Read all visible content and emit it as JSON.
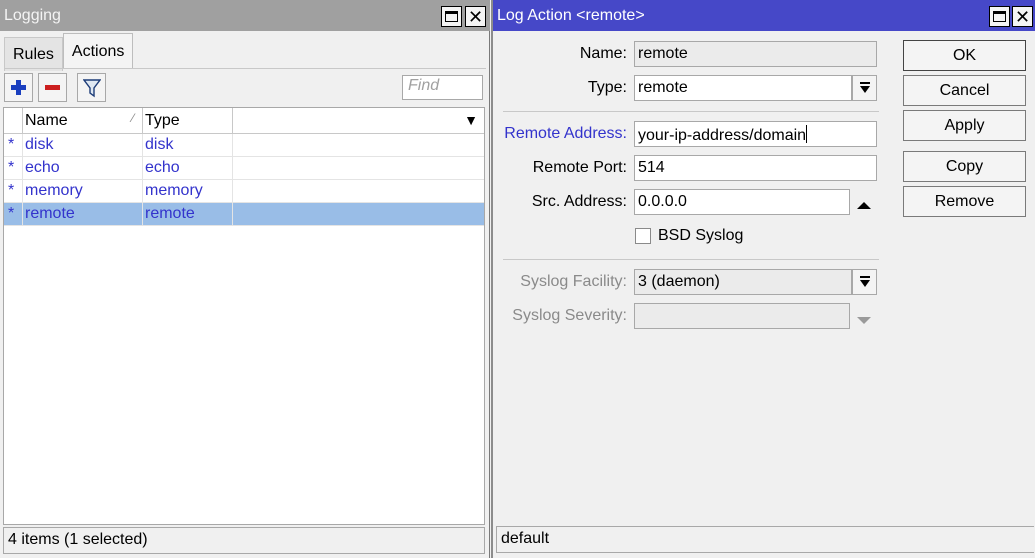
{
  "logging_window": {
    "title": "Logging",
    "tabs": [
      {
        "label": "Rules",
        "active": false
      },
      {
        "label": "Actions",
        "active": true
      }
    ],
    "toolbar": {
      "add_icon": "plus-icon",
      "remove_icon": "minus-icon",
      "filter_icon": "filter-icon",
      "find_placeholder": "Find"
    },
    "table": {
      "columns": [
        "Name",
        "Type"
      ],
      "rows": [
        {
          "mark": "*",
          "name": "disk",
          "type": "disk",
          "selected": false
        },
        {
          "mark": "*",
          "name": "echo",
          "type": "echo",
          "selected": false
        },
        {
          "mark": "*",
          "name": "memory",
          "type": "memory",
          "selected": false
        },
        {
          "mark": "*",
          "name": "remote",
          "type": "remote",
          "selected": true
        }
      ]
    },
    "status": "4 items (1 selected)"
  },
  "action_window": {
    "title": "Log Action <remote>",
    "form": {
      "name_label": "Name:",
      "name_value": "remote",
      "type_label": "Type:",
      "type_value": "remote",
      "remote_address_label": "Remote Address:",
      "remote_address_value": "your-ip-address/domain",
      "remote_port_label": "Remote Port:",
      "remote_port_value": "514",
      "src_address_label": "Src. Address:",
      "src_address_value": "0.0.0.0",
      "bsd_syslog_label": "BSD Syslog",
      "bsd_syslog_checked": false,
      "syslog_facility_label": "Syslog Facility:",
      "syslog_facility_value": "3 (daemon)",
      "syslog_severity_label": "Syslog Severity:",
      "syslog_severity_value": ""
    },
    "buttons": {
      "ok": "OK",
      "cancel": "Cancel",
      "apply": "Apply",
      "copy": "Copy",
      "remove": "Remove"
    },
    "status": "default"
  },
  "colors": {
    "active_title": "#4648c8",
    "inactive_title": "#a0a0a0",
    "selected_row": "#99bde7",
    "link_text": "#3333cc",
    "add_icon": "#1a3fbf",
    "remove_icon": "#cc1f1f"
  }
}
